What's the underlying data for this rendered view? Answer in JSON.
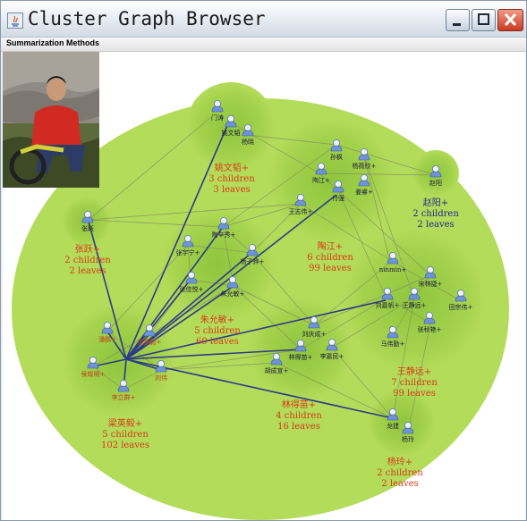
{
  "window": {
    "title": "Cluster Graph Browser"
  },
  "menu": {
    "summarization_methods": "Summarization Methods"
  },
  "colors": {
    "cluster_label": "#d83a16",
    "cluster_label_alt": "#1f2a8c",
    "edge_thick": "#2e3a88",
    "edge_thin": "#7f8c66",
    "bubble": "#b3dc5a"
  },
  "graph": {
    "clusters": [
      {
        "name": "姚文韬+",
        "children": "3 children",
        "leaves": "3 leaves"
      },
      {
        "name": "陶江+",
        "children": "6 children",
        "leaves": "99 leaves"
      },
      {
        "name": "赵阳+",
        "children": "2 children",
        "leaves": "2 leaves"
      },
      {
        "name": "张跃+",
        "children": "2 children",
        "leaves": "2 leaves"
      },
      {
        "name": "朱允敏+",
        "children": "5 children",
        "leaves": "69 leaves"
      },
      {
        "name": "王静远+",
        "children": "7 children",
        "leaves": "99 leaves"
      },
      {
        "name": "梁英毅+",
        "children": "5 children",
        "leaves": "102 leaves"
      },
      {
        "name": "林得苗+",
        "children": "4 children",
        "leaves": "16 leaves"
      },
      {
        "name": "杨玲+",
        "children": "2 children",
        "leaves": "2 leaves"
      }
    ],
    "nodes": [
      "门涛",
      "姚文韬",
      "杨晓",
      "孙枫",
      "杨薇欣+",
      "陶江+",
      "付强",
      "姜睿+",
      "王志伟+",
      "赵阳",
      "张跃",
      "陶辛秀+",
      "张宇宁+",
      "杨子骅+",
      "张佳悦+",
      "朱允敏+",
      "ninmin+",
      "宋林捷+",
      "刘嘉帆+",
      "王静远+",
      "田宗伟+",
      "张秋艳+",
      "马伟勤+",
      "刘庆成+",
      "林得苗+",
      "李嘉民+",
      "胡成宣+",
      "潘鹏+",
      "梁英毅+",
      "侯晓明+",
      "李立群+",
      "刘伟",
      "龙建",
      "杨玲"
    ]
  }
}
